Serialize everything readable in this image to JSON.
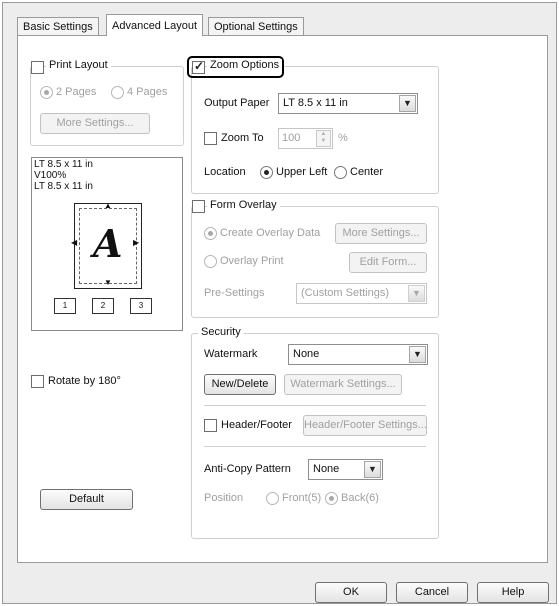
{
  "tabs": [
    {
      "label": "Basic Settings"
    },
    {
      "label": "Advanced Layout"
    },
    {
      "label": "Optional Settings"
    }
  ],
  "print_layout": {
    "label": "Print Layout",
    "checked": false,
    "opt_2pages": "2 Pages",
    "opt_4pages": "4 Pages",
    "more_settings": "More Settings..."
  },
  "preview": {
    "line1": "LT 8.5 x 11 in",
    "line2": "V100%",
    "line3": "LT 8.5 x 11 in",
    "letter": "A",
    "icon1": "1",
    "icon2": "2",
    "icon3": "3"
  },
  "rotate": {
    "label": "Rotate by 180°",
    "checked": false
  },
  "default_button": "Default",
  "zoom": {
    "label": "Zoom Options",
    "checked": true,
    "output_paper_label": "Output Paper",
    "output_paper_value": "LT 8.5 x 11 in",
    "zoom_to_label": "Zoom To",
    "zoom_to_value": "100",
    "zoom_unit": "%",
    "location_label": "Location",
    "loc_upper_left": "Upper Left",
    "loc_center": "Center",
    "location_selected": "Upper Left"
  },
  "form_overlay": {
    "label": "Form Overlay",
    "checked": false,
    "create_label": "Create Overlay Data",
    "more_settings": "More Settings...",
    "overlay_print": "Overlay Print",
    "edit_form": "Edit Form...",
    "presettings_label": "Pre-Settings",
    "presettings_value": "(Custom Settings)"
  },
  "security": {
    "label": "Security",
    "watermark_label": "Watermark",
    "watermark_value": "None",
    "new_delete": "New/Delete",
    "watermark_settings": "Watermark Settings...",
    "header_footer_label": "Header/Footer",
    "header_footer_checked": false,
    "header_footer_settings": "Header/Footer Settings...",
    "anticopy_label": "Anti-Copy Pattern",
    "anticopy_value": "None",
    "position_label": "Position",
    "front": "Front(5)",
    "back": "Back(6)"
  },
  "bottom_buttons": {
    "ok": "OK",
    "cancel": "Cancel",
    "help": "Help"
  },
  "icons": {
    "dropdown": "chevron-down-icon",
    "spinner": "spinner-arrows-icon",
    "checkmark": "checkmark-icon"
  }
}
